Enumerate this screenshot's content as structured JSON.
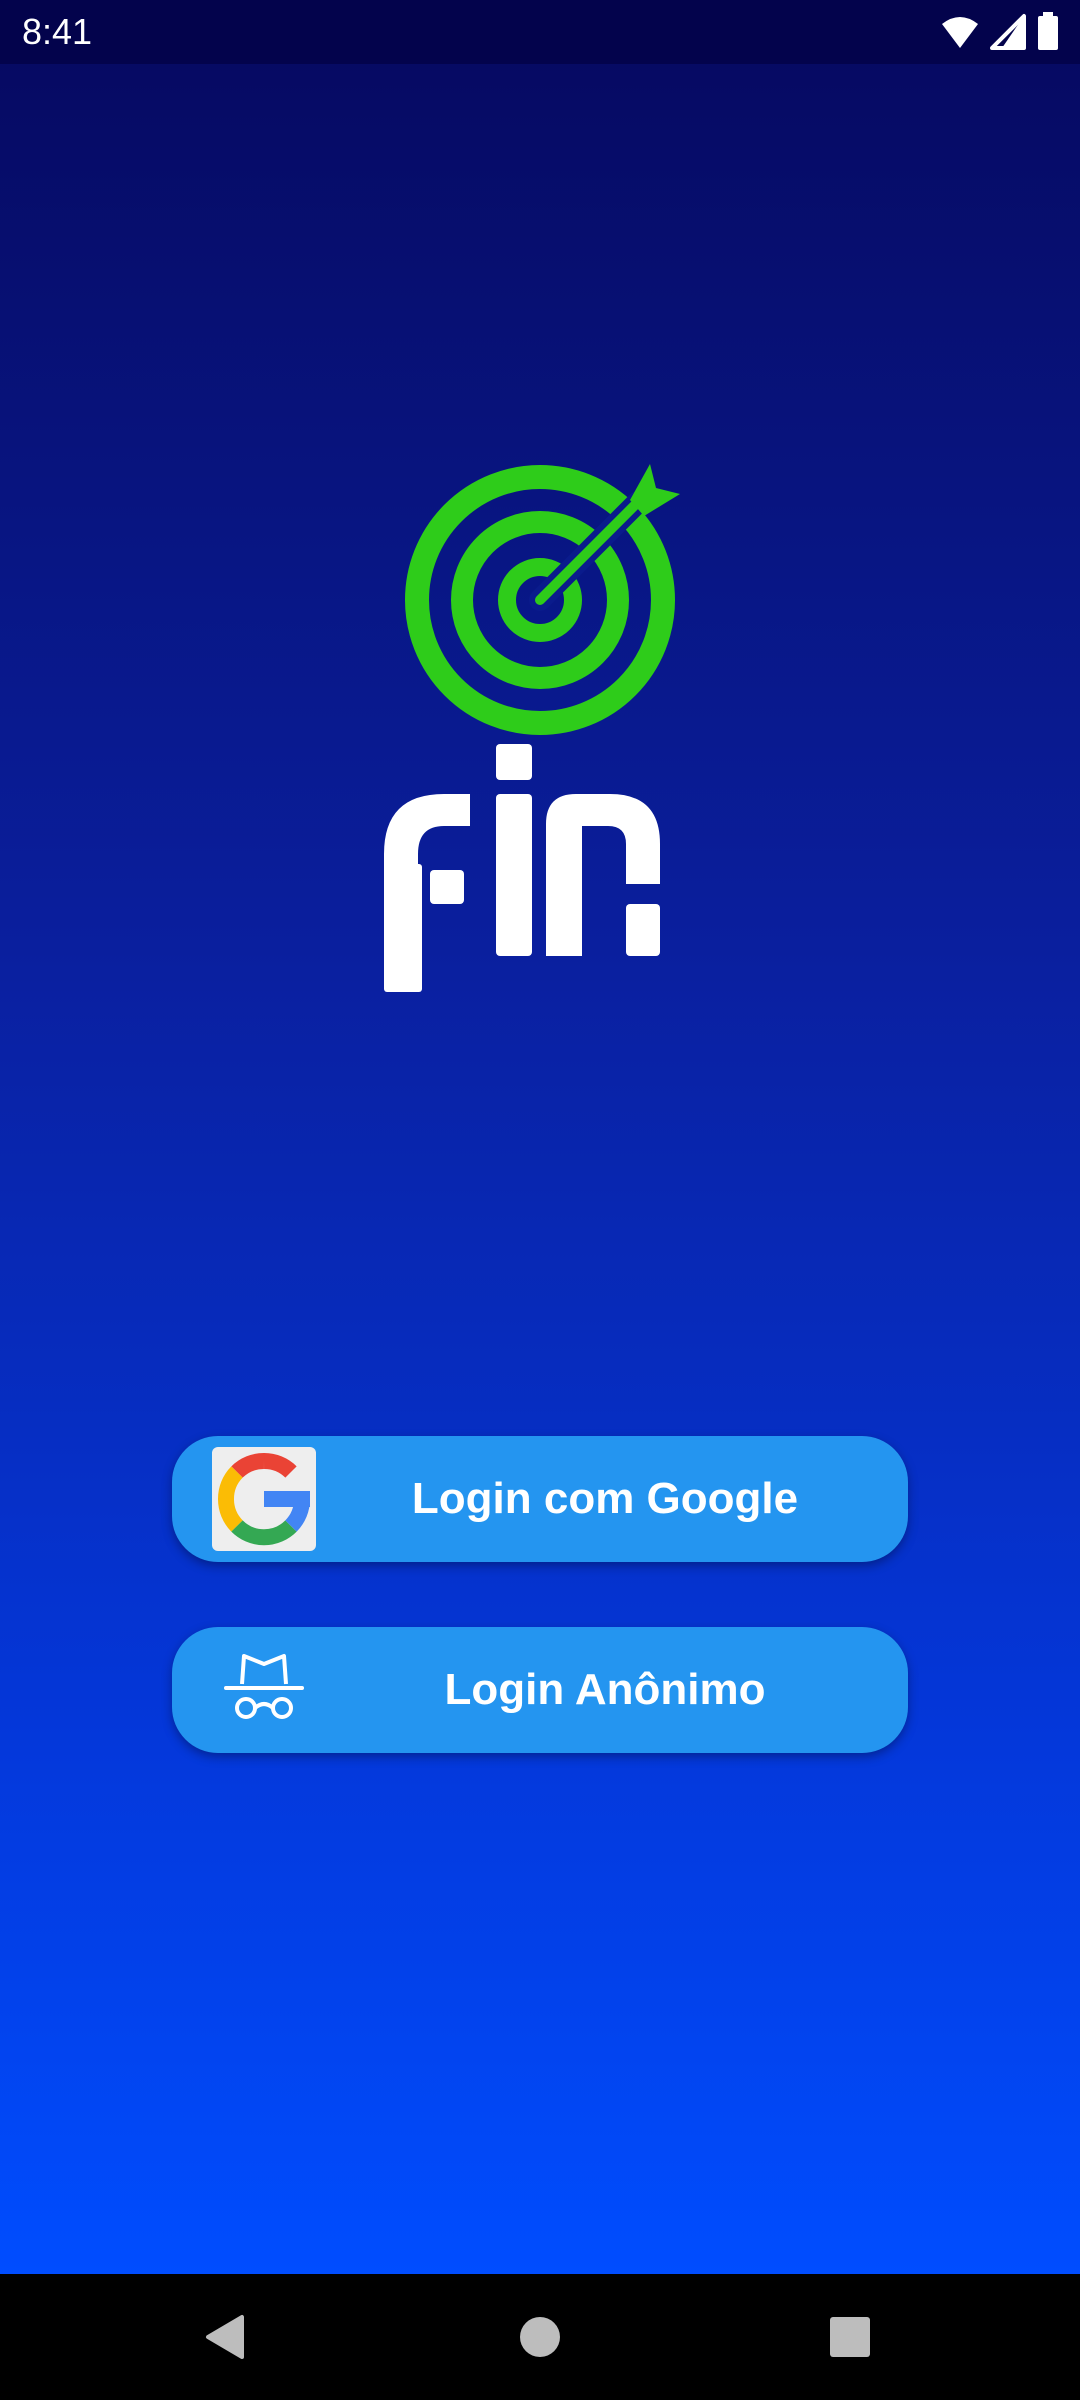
{
  "status_bar": {
    "time": "8:41",
    "icons": [
      "wifi-icon",
      "cell-signal-icon",
      "battery-icon"
    ]
  },
  "app": {
    "logo_text": "fin",
    "logo_icon": "target-arrow-icon",
    "colors": {
      "background_top": "#060a63",
      "background_bottom": "#004dff",
      "button": "#2495f0",
      "logo_green": "#2ecc1a"
    }
  },
  "buttons": {
    "google": {
      "label": "Login com Google",
      "icon": "google-icon"
    },
    "anonymous": {
      "label": "Login Anônimo",
      "icon": "incognito-icon"
    }
  },
  "nav_bar": {
    "icons": [
      "back-icon",
      "home-icon",
      "recents-icon"
    ]
  }
}
